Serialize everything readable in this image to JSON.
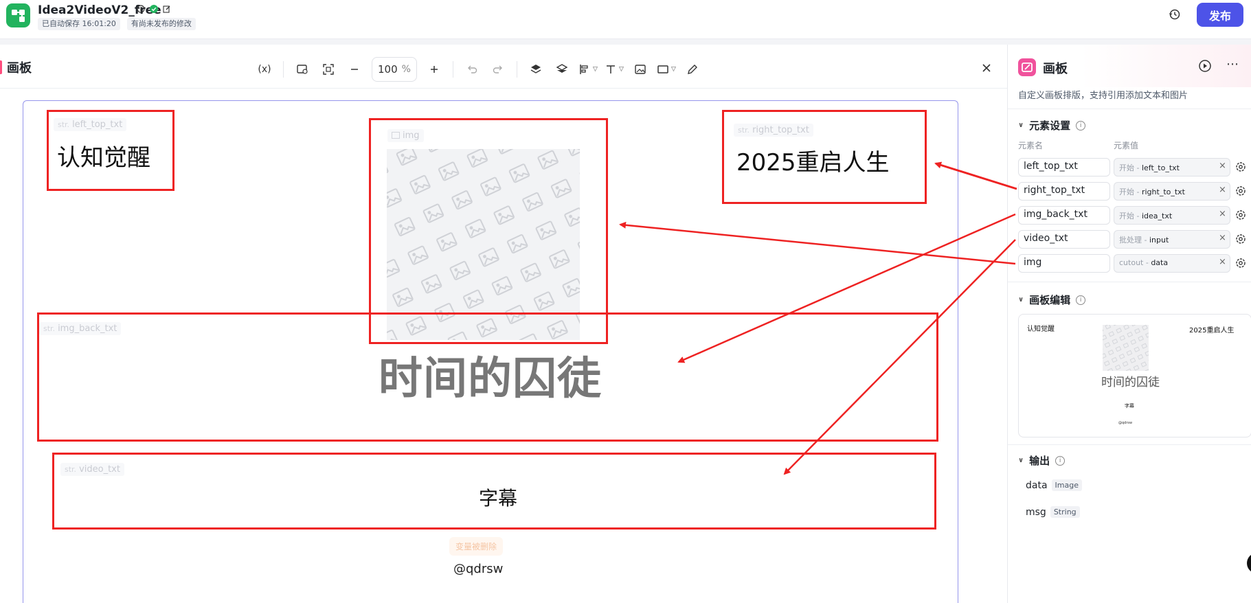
{
  "header": {
    "app_name": "Idea2VideoV2_free",
    "autosave": "已自动保存 16:01:20",
    "unpublished": "有尚未发布的修改",
    "publish_label": "发布"
  },
  "canvas_panel": {
    "title": "画板",
    "zoom_value": "100",
    "zoom_unit": "%",
    "variable_label": "(x)"
  },
  "artboard": {
    "elements": [
      {
        "type_tag": "str.",
        "name": "left_top_txt",
        "text": "认知觉醒"
      },
      {
        "type_tag": "",
        "name": "img",
        "text": ""
      },
      {
        "type_tag": "str.",
        "name": "right_top_txt",
        "text": "2025重启人生"
      },
      {
        "type_tag": "str.",
        "name": "img_back_txt",
        "text": "时间的囚徒"
      },
      {
        "type_tag": "str.",
        "name": "video_txt",
        "text": "字幕"
      }
    ],
    "deleted_badge": "变量被删除",
    "watermark": "@qdrsw"
  },
  "right_panel": {
    "title": "画板",
    "description": "自定义画板排版，支持引用添加文本和图片",
    "element_settings_title": "元素设置",
    "col_name": "元素名",
    "col_value": "元素值",
    "fields": [
      {
        "name": "left_top_txt",
        "source": "开始",
        "value": "left_to_txt"
      },
      {
        "name": "right_top_txt",
        "source": "开始",
        "value": "right_to_txt"
      },
      {
        "name": "img_back_txt",
        "source": "开始",
        "value": "idea_txt"
      },
      {
        "name": "video_txt",
        "source": "批处理",
        "value": "input"
      },
      {
        "name": "img",
        "source": "cutout",
        "value": "data"
      }
    ],
    "canvas_edit_title": "画板编辑",
    "preview": {
      "left_top": "认知觉醒",
      "right_top": "2025重启人生",
      "title": "时间的囚徒",
      "sub": "字幕",
      "watermark": "@qdrsw"
    },
    "output_title": "输出",
    "outputs": [
      {
        "name": "data",
        "type": "Image"
      },
      {
        "name": "msg",
        "type": "String"
      }
    ]
  },
  "colors": {
    "accent": "#4d53e8",
    "annotation": "#ee2222",
    "logo": "#22b35e",
    "node_icon": "#f0529c"
  }
}
